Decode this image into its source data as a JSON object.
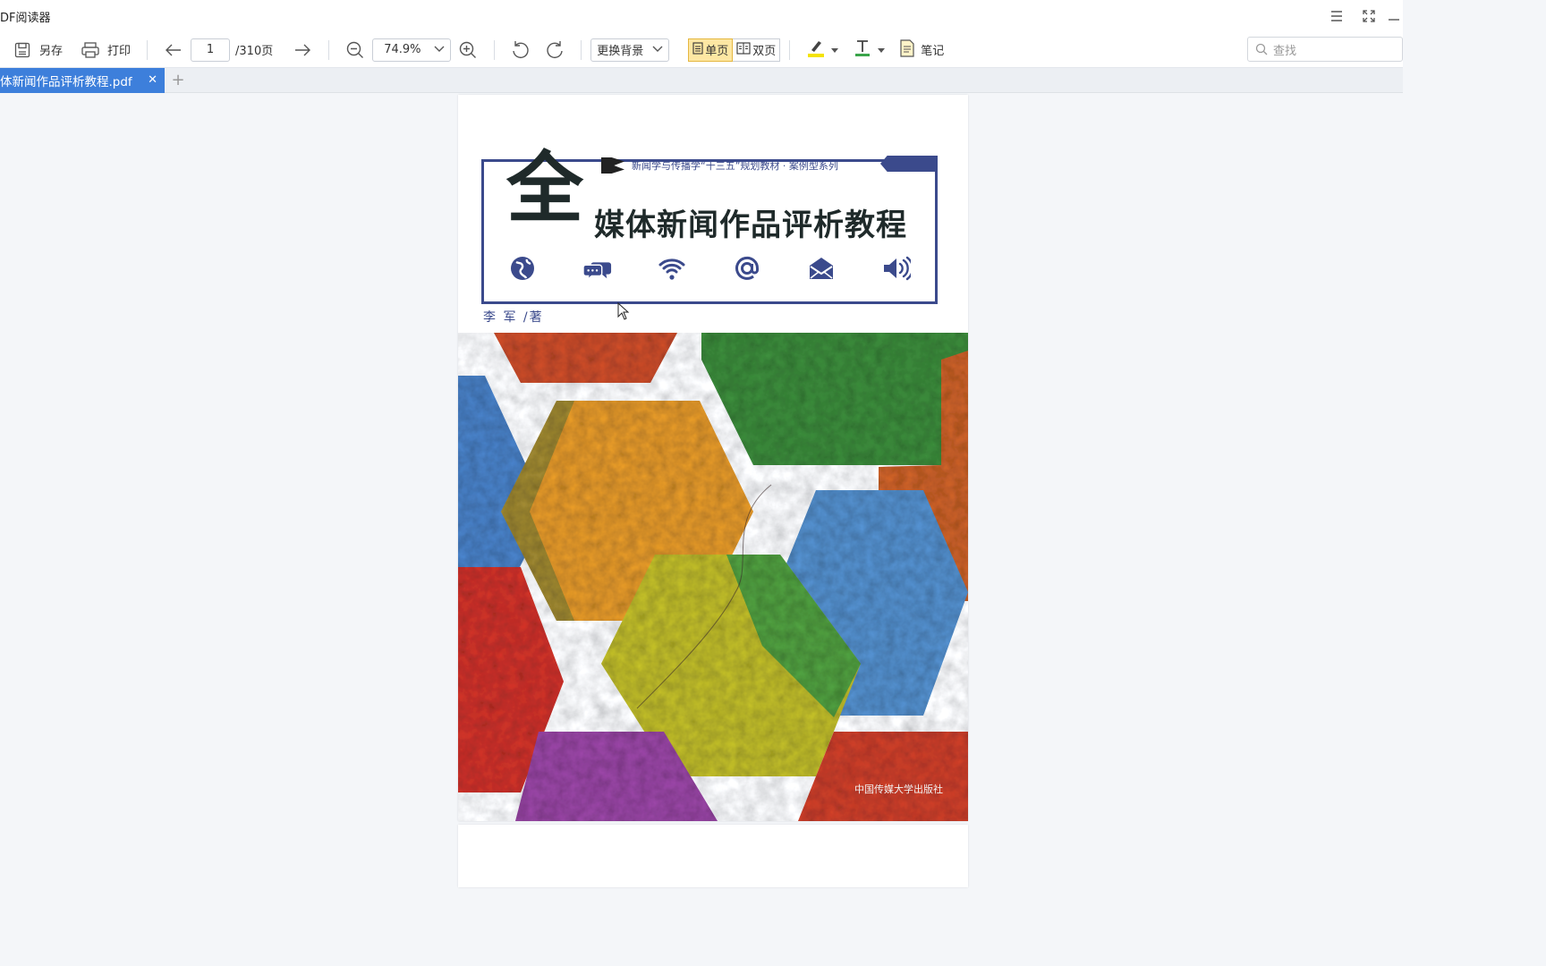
{
  "app": {
    "title": "DF阅读器"
  },
  "window_controls": {
    "menu_icon": "menu-icon",
    "restore_icon": "restore-icon",
    "minimize_icon": "minimize-icon"
  },
  "toolbar": {
    "save_as_label": "另存",
    "print_label": "打印",
    "page_current": "1",
    "page_total": "/310页",
    "zoom_value": "74.9%",
    "background_label": "更换背景",
    "single_page_label": "单页",
    "double_page_label": "双页",
    "notes_label": "笔记",
    "search_placeholder": "查找",
    "highlight_color": "#f4e300",
    "text_color": "#3aa54a"
  },
  "tabs": [
    {
      "label": "体新闻作品评析教程.pdf",
      "active": true
    }
  ],
  "document": {
    "series": "新闻学与传播学“十三五”规划教材 · 案例型系列",
    "big_char": "全",
    "title": "媒体新闻作品评析教程",
    "author": "李 军 /著",
    "publisher": "中国传媒大学出版社",
    "cover_icons": [
      "globe-icon",
      "chat-bubbles-icon",
      "wifi-icon",
      "at-sign-icon",
      "envelope-icon",
      "speaker-icon"
    ],
    "accent_color": "#3b4a8c"
  }
}
